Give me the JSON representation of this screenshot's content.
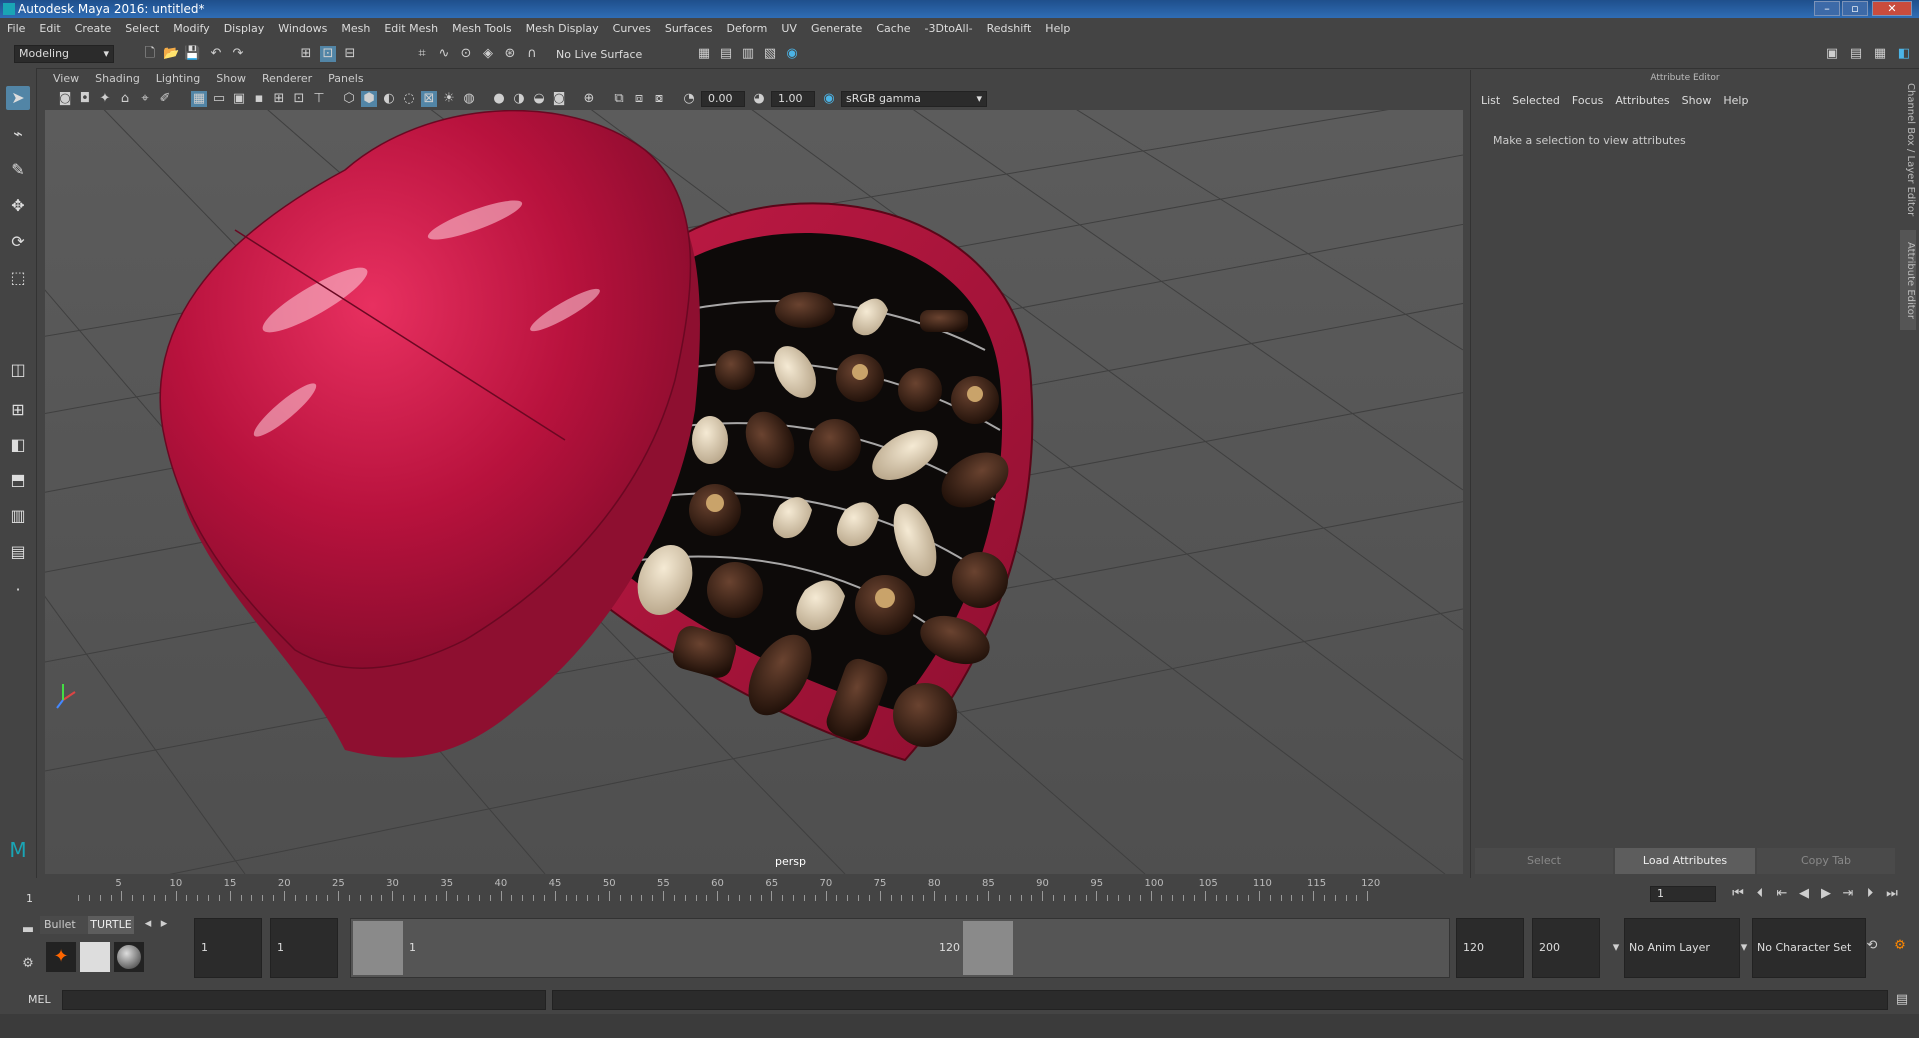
{
  "window": {
    "title": "Autodesk Maya 2016: untitled*"
  },
  "menubar": [
    "File",
    "Edit",
    "Create",
    "Select",
    "Modify",
    "Display",
    "Windows",
    "Mesh",
    "Edit Mesh",
    "Mesh Tools",
    "Mesh Display",
    "Curves",
    "Surfaces",
    "Deform",
    "UV",
    "Generate",
    "Cache",
    "-3DtoAll-",
    "Redshift",
    "Help"
  ],
  "statusline": {
    "mode": "Modeling",
    "live_surface": "No Live Surface"
  },
  "viewport": {
    "menus": [
      "View",
      "Shading",
      "Lighting",
      "Show",
      "Renderer",
      "Panels"
    ],
    "exposure": "0.00",
    "gamma": "1.00",
    "color_space": "sRGB gamma",
    "camera_label": "persp"
  },
  "attribute_editor": {
    "title": "Attribute Editor",
    "menus": [
      "List",
      "Selected",
      "Focus",
      "Attributes",
      "Show",
      "Help"
    ],
    "message": "Make a selection to view attributes",
    "buttons": {
      "select": "Select",
      "load": "Load Attributes",
      "copy": "Copy Tab"
    }
  },
  "side_tabs": {
    "channel_box": "Channel Box / Layer Editor",
    "attr_editor": "Attribute Editor"
  },
  "timeline": {
    "ticks": [
      "5",
      "10",
      "15",
      "20",
      "25",
      "30",
      "35",
      "40",
      "45",
      "50",
      "55",
      "60",
      "65",
      "70",
      "75",
      "80",
      "85",
      "90",
      "95",
      "100",
      "105",
      "110",
      "115",
      "120"
    ],
    "start_marker": "1",
    "current_frame": "1"
  },
  "range": {
    "shelf_tabs": [
      "Bullet",
      "TURTLE"
    ],
    "start": "1",
    "playback_start": "1",
    "slider_start": "1",
    "slider_end": "120",
    "playback_end": "120",
    "end": "200",
    "anim_layer": "No Anim Layer",
    "character_set": "No Character Set"
  },
  "cmd": {
    "label": "MEL"
  }
}
